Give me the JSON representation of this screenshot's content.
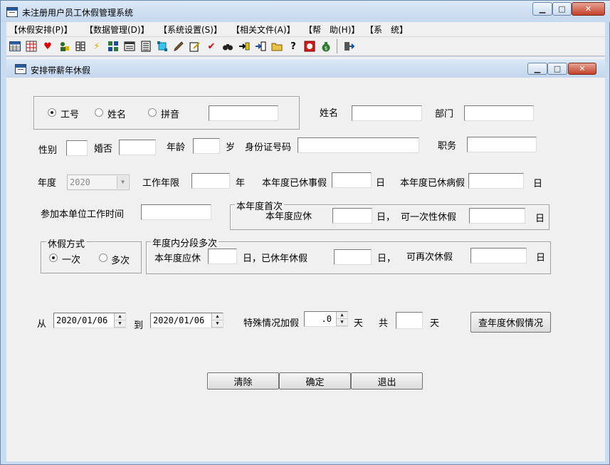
{
  "window": {
    "title": "未注册用户员工休假管理系统"
  },
  "menu": [
    "【休假安排(P)】",
    "【数据管理(D)】",
    "【系统设置(S)】",
    "【相关文件(A)】",
    "【帮　助(H)】",
    "【系　统】"
  ],
  "toolbar_icons": [
    "table-icon",
    "grid-icon",
    "heart-icon",
    "user-key-icon",
    "columns-icon",
    "lightning-icon",
    "cards-icon",
    "calendar-icon",
    "list-icon",
    "select-icon",
    "pencil-icon",
    "note-edit-icon",
    "checkmark-icon",
    "binoculars-icon",
    "arrow-in-icon",
    "login-icon",
    "folder-open-icon",
    "help-icon",
    "stop-icon",
    "money-bag-icon",
    "exit-icon"
  ],
  "child": {
    "title": "安排带薪年休假"
  },
  "search": {
    "opt_id": "工号",
    "opt_name": "姓名",
    "opt_pinyin": "拼音",
    "value": ""
  },
  "labels": {
    "name": "姓名",
    "dept": "部门",
    "gender": "性别",
    "married": "婚否",
    "age": "年龄",
    "age_unit": "岁",
    "id_card": "身份证号码",
    "position": "职务",
    "year": "年度",
    "work_years": "工作年限",
    "year_unit": "年",
    "personal_leave": "本年度已休事假",
    "day_unit": "日",
    "sick_leave": "本年度已休病假",
    "join_time": "参加本单位工作时间",
    "first_group": "本年度首次",
    "due": "本年度应休",
    "due_first_tail": "日，",
    "one_time": "可一次性休假",
    "mode_group": "休假方式",
    "mode_once": "一次",
    "mode_multi": "多次",
    "multi_group": "年度内分段多次",
    "rested": "日，已休年休假",
    "rested_tail": "日，",
    "again": "可再次休假",
    "from": "从",
    "to": "到",
    "special": "特殊情况加假",
    "days": "天",
    "total": "共"
  },
  "fields": {
    "year": "2020",
    "from_date": "2020/01/06",
    "to_date": "2020/01/06",
    "special_days": ".0"
  },
  "buttons": {
    "query": "查年度休假情况",
    "clear": "清除",
    "ok": "确定",
    "exit": "退出"
  }
}
